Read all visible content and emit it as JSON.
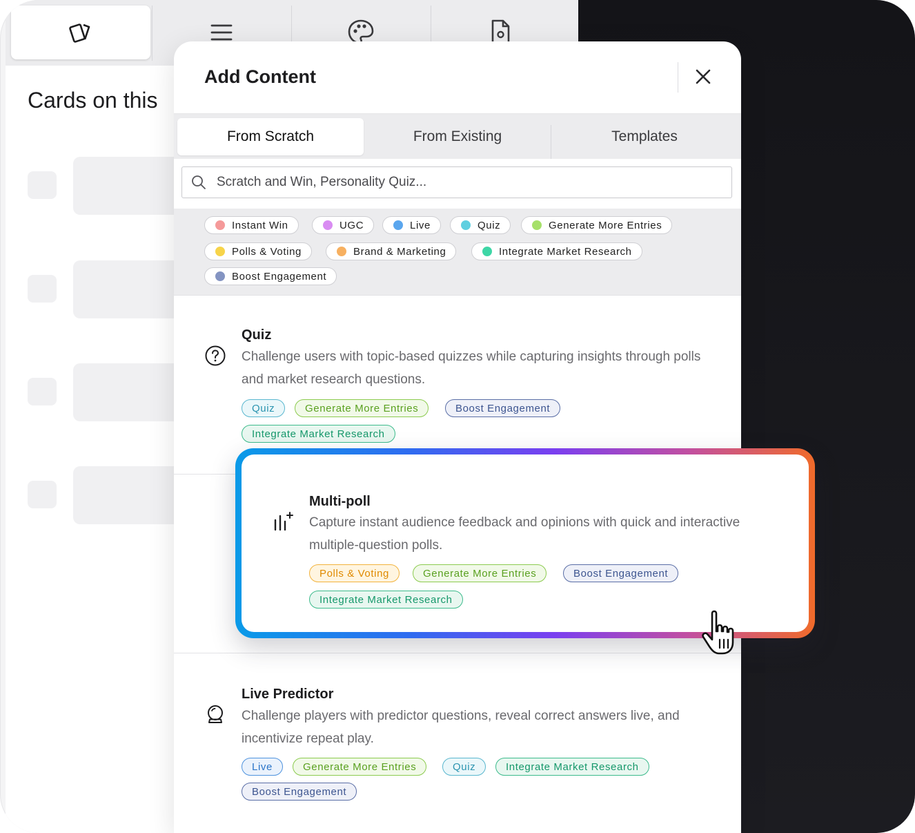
{
  "page": {
    "title": "Cards on this"
  },
  "toolbar": {
    "icons": [
      "cards-icon",
      "menu-icon",
      "palette-icon",
      "file-settings-icon"
    ]
  },
  "modal": {
    "title": "Add Content",
    "tabs": [
      {
        "label": "From Scratch",
        "active": true
      },
      {
        "label": "From Existing",
        "active": false
      },
      {
        "label": "Templates",
        "active": false
      }
    ],
    "search_placeholder": "Scratch and Win, Personality Quiz...",
    "filters": [
      {
        "label": "Instant Win",
        "color": "#f59a9a"
      },
      {
        "label": "UGC",
        "color": "#d98cf2"
      },
      {
        "label": "Live",
        "color": "#5aa6ee"
      },
      {
        "label": "Quiz",
        "color": "#5fcfe0"
      },
      {
        "label": "Generate More Entries",
        "color": "#a6e06a"
      },
      {
        "label": "Polls & Voting",
        "color": "#f7d44a"
      },
      {
        "label": "Brand & Marketing",
        "color": "#f7b060"
      },
      {
        "label": "Integrate Market Research",
        "color": "#3ed6a6"
      },
      {
        "label": "Boost Engagement",
        "color": "#8494c2"
      }
    ],
    "items": [
      {
        "title": "Quiz",
        "icon": "question-circle-icon",
        "description": "Challenge users with topic-based quizzes while capturing insights through polls and market research questions.",
        "tags": [
          "Quiz",
          "Generate More Entries",
          "Boost Engagement",
          "Integrate Market Research"
        ]
      },
      {
        "title": "Multi-poll",
        "icon": "poll-bars-icon",
        "description": "Capture instant audience feedback and opinions with quick and interactive multiple-question polls.",
        "tags": [
          "Polls & Voting",
          "Generate More Entries",
          "Boost Engagement",
          "Integrate Market Research"
        ]
      },
      {
        "title": "Live Predictor",
        "icon": "crystal-ball-icon",
        "description": "Challenge players with predictor questions, reveal correct answers live, and incentivize repeat play.",
        "tags": [
          "Live",
          "Generate More Entries",
          "Quiz",
          "Integrate Market Research",
          "Boost Engagement"
        ]
      }
    ]
  }
}
